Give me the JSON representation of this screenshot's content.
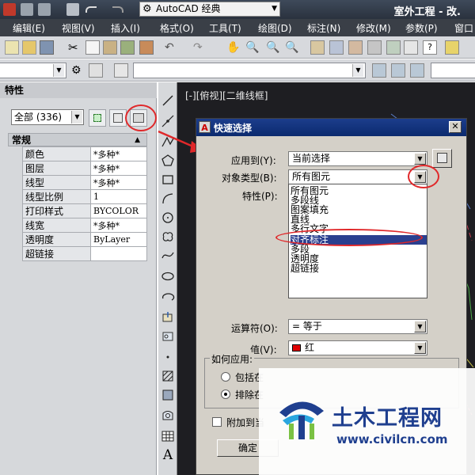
{
  "titlebar": {
    "workspace": "AutoCAD 经典",
    "app_title": "室外工程 - 改."
  },
  "menubar": {
    "items": [
      "编辑(E)",
      "视图(V)",
      "插入(I)",
      "格式(O)",
      "工具(T)",
      "绘图(D)",
      "标注(N)",
      "修改(M)",
      "参数(P)",
      "窗口"
    ]
  },
  "palette": {
    "title": "特性",
    "selection": "全部 (336)",
    "section": "常规",
    "properties": [
      {
        "key": "颜色",
        "value": "*多种*"
      },
      {
        "key": "图层",
        "value": "*多种*"
      },
      {
        "key": "线型",
        "value": "*多种*"
      },
      {
        "key": "线型比例",
        "value": "1"
      },
      {
        "key": "打印样式",
        "value": "BYCOLOR"
      },
      {
        "key": "线宽",
        "value": "*多种*"
      },
      {
        "key": "透明度",
        "value": "ByLayer"
      },
      {
        "key": "超链接",
        "value": ""
      }
    ]
  },
  "drawbar": {
    "icons": [
      "line-icon",
      "construction-line-icon",
      "polyline-icon",
      "polygon-icon",
      "rectangle-icon",
      "arc-icon",
      "circle-icon",
      "revcloud-icon",
      "spline-icon",
      "ellipse-icon",
      "ellipse-arc-icon",
      "insert-block-icon",
      "make-block-icon",
      "point-icon",
      "hatch-icon",
      "gradient-icon",
      "region-icon",
      "table-icon",
      "mtext-icon"
    ],
    "text_label": "A"
  },
  "canvas": {
    "viewport_label": "[-][俯视][二维线框]"
  },
  "dialog": {
    "title": "快速选择",
    "apply_to_label": "应用到(Y):",
    "apply_to_value": "当前选择",
    "object_type_label": "对象类型(B):",
    "object_type_value": "所有图元",
    "properties_label": "特性(P):",
    "object_types": [
      "所有图元",
      "多段线",
      "图案填充",
      "直线",
      "多行文字",
      "对齐标注",
      "多段",
      "透明度",
      "超链接"
    ],
    "selected_type_index": 5,
    "operator_label": "运算符(O):",
    "operator_value": "= 等于",
    "value_label": "值(V):",
    "value_value": "红",
    "value_color": "#e00000",
    "how_apply_label": "如何应用:",
    "include_label": "包括在",
    "exclude_label": "排除在",
    "append_label": "附加到当",
    "ok_label": "确定"
  },
  "watermark": {
    "name": "土木工程网",
    "url": "www.civilcn.com"
  },
  "annotation_color": "#e0282a"
}
